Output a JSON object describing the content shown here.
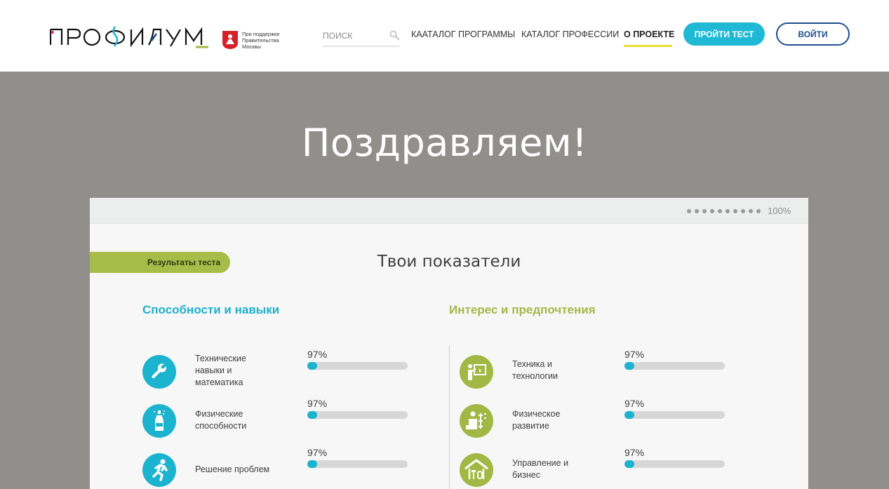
{
  "header": {
    "logo_text": "ПРОФИЛУМ",
    "support_text": [
      "При поддержке",
      "Правительства",
      "Москвы"
    ],
    "search": {
      "placeholder": "ПОИСК"
    },
    "nav": [
      {
        "label": "КААТАЛОГ ПРОГРАММЫ"
      },
      {
        "label": "КАТАЛОГ ПРОФЕССИИ"
      },
      {
        "label": "О ПРОЕКТЕ",
        "active": true
      }
    ],
    "take_test_label": "ПРОЙТИ ТЕСТ",
    "login_label": "ВОЙТИ"
  },
  "hero": {
    "title": "Поздравляем!"
  },
  "card": {
    "progress": {
      "dots": 10,
      "label": "100%",
      "value": 1.0
    },
    "results_tab": "Результаты теста",
    "title": "Твои показатели",
    "abilities": {
      "title": "Способности и навыки",
      "items": [
        {
          "label": "Технические навыки и математика",
          "percent": "97%",
          "value": 0.97,
          "icon": "wrench-icon"
        },
        {
          "label": "Физические способности",
          "percent": "97%",
          "value": 0.97,
          "icon": "bottle-icon"
        },
        {
          "label": "Решение проблем",
          "percent": "97%",
          "value": 0.97,
          "icon": "runner-icon"
        }
      ]
    },
    "interests": {
      "title": "Интерес и предпочтения",
      "items": [
        {
          "label": "Техника и технологии",
          "percent": "97%",
          "value": 0.97,
          "icon": "presenter-icon"
        },
        {
          "label": "Физическое развитие",
          "percent": "97%",
          "value": 0.97,
          "icon": "fitness-icon"
        },
        {
          "label": "Управление и бизнес",
          "percent": "97%",
          "value": 0.97,
          "icon": "house-tools-icon"
        }
      ]
    }
  },
  "colors": {
    "accent_blue": "#1cb3cf",
    "accent_green": "#a3b745",
    "nav_underline": "#e6e034",
    "login_border": "#1c4f8f",
    "hero_bg": "#918f8c"
  }
}
